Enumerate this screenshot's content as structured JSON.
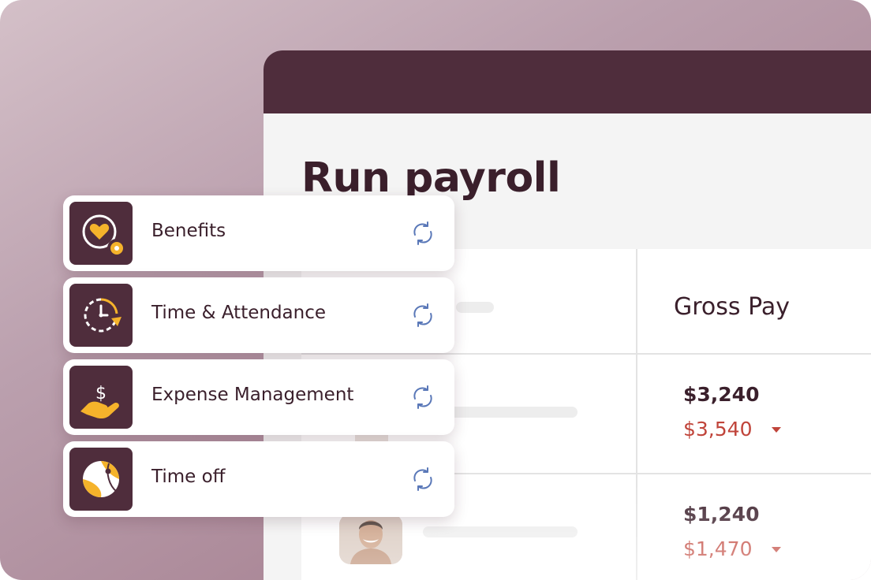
{
  "page": {
    "title": "Run payroll"
  },
  "table": {
    "gross_pay_header": "Gross Pay",
    "rows": [
      {
        "current": "$3,240",
        "previous": "$3,540",
        "avatar": "employee-avatar-woman"
      },
      {
        "current": "$1,240",
        "previous": "$1,470",
        "avatar": "employee-avatar-man"
      }
    ]
  },
  "integrations": [
    {
      "label": "Benefits",
      "icon": "heart-gear-icon",
      "status_icon": "sync-icon"
    },
    {
      "label": "Time & Attendance",
      "icon": "clock-arrow-icon",
      "status_icon": "sync-icon"
    },
    {
      "label": "Expense Management",
      "icon": "hand-dollar-icon",
      "status_icon": "sync-icon"
    },
    {
      "label": "Time off",
      "icon": "beach-ball-icon",
      "status_icon": "sync-icon"
    }
  ],
  "colors": {
    "brand_plum": "#4f2d3c",
    "accent_gold": "#f5b32b",
    "negative_red": "#c0443a",
    "sync_blue": "#5a78b8"
  }
}
